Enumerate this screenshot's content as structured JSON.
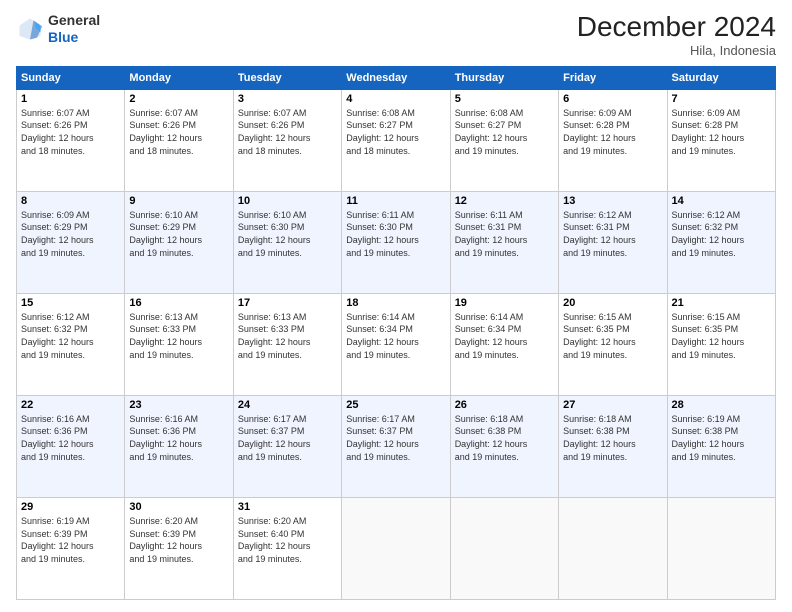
{
  "logo": {
    "general": "General",
    "blue": "Blue"
  },
  "header": {
    "month": "December 2024",
    "location": "Hila, Indonesia"
  },
  "days_of_week": [
    "Sunday",
    "Monday",
    "Tuesday",
    "Wednesday",
    "Thursday",
    "Friday",
    "Saturday"
  ],
  "weeks": [
    [
      {
        "day": "1",
        "sunrise": "6:07 AM",
        "sunset": "6:26 PM",
        "daylight": "12 hours and 18 minutes."
      },
      {
        "day": "2",
        "sunrise": "6:07 AM",
        "sunset": "6:26 PM",
        "daylight": "12 hours and 18 minutes."
      },
      {
        "day": "3",
        "sunrise": "6:07 AM",
        "sunset": "6:26 PM",
        "daylight": "12 hours and 18 minutes."
      },
      {
        "day": "4",
        "sunrise": "6:08 AM",
        "sunset": "6:27 PM",
        "daylight": "12 hours and 18 minutes."
      },
      {
        "day": "5",
        "sunrise": "6:08 AM",
        "sunset": "6:27 PM",
        "daylight": "12 hours and 19 minutes."
      },
      {
        "day": "6",
        "sunrise": "6:09 AM",
        "sunset": "6:28 PM",
        "daylight": "12 hours and 19 minutes."
      },
      {
        "day": "7",
        "sunrise": "6:09 AM",
        "sunset": "6:28 PM",
        "daylight": "12 hours and 19 minutes."
      }
    ],
    [
      {
        "day": "8",
        "sunrise": "6:09 AM",
        "sunset": "6:29 PM",
        "daylight": "12 hours and 19 minutes."
      },
      {
        "day": "9",
        "sunrise": "6:10 AM",
        "sunset": "6:29 PM",
        "daylight": "12 hours and 19 minutes."
      },
      {
        "day": "10",
        "sunrise": "6:10 AM",
        "sunset": "6:30 PM",
        "daylight": "12 hours and 19 minutes."
      },
      {
        "day": "11",
        "sunrise": "6:11 AM",
        "sunset": "6:30 PM",
        "daylight": "12 hours and 19 minutes."
      },
      {
        "day": "12",
        "sunrise": "6:11 AM",
        "sunset": "6:31 PM",
        "daylight": "12 hours and 19 minutes."
      },
      {
        "day": "13",
        "sunrise": "6:12 AM",
        "sunset": "6:31 PM",
        "daylight": "12 hours and 19 minutes."
      },
      {
        "day": "14",
        "sunrise": "6:12 AM",
        "sunset": "6:32 PM",
        "daylight": "12 hours and 19 minutes."
      }
    ],
    [
      {
        "day": "15",
        "sunrise": "6:12 AM",
        "sunset": "6:32 PM",
        "daylight": "12 hours and 19 minutes."
      },
      {
        "day": "16",
        "sunrise": "6:13 AM",
        "sunset": "6:33 PM",
        "daylight": "12 hours and 19 minutes."
      },
      {
        "day": "17",
        "sunrise": "6:13 AM",
        "sunset": "6:33 PM",
        "daylight": "12 hours and 19 minutes."
      },
      {
        "day": "18",
        "sunrise": "6:14 AM",
        "sunset": "6:34 PM",
        "daylight": "12 hours and 19 minutes."
      },
      {
        "day": "19",
        "sunrise": "6:14 AM",
        "sunset": "6:34 PM",
        "daylight": "12 hours and 19 minutes."
      },
      {
        "day": "20",
        "sunrise": "6:15 AM",
        "sunset": "6:35 PM",
        "daylight": "12 hours and 19 minutes."
      },
      {
        "day": "21",
        "sunrise": "6:15 AM",
        "sunset": "6:35 PM",
        "daylight": "12 hours and 19 minutes."
      }
    ],
    [
      {
        "day": "22",
        "sunrise": "6:16 AM",
        "sunset": "6:36 PM",
        "daylight": "12 hours and 19 minutes."
      },
      {
        "day": "23",
        "sunrise": "6:16 AM",
        "sunset": "6:36 PM",
        "daylight": "12 hours and 19 minutes."
      },
      {
        "day": "24",
        "sunrise": "6:17 AM",
        "sunset": "6:37 PM",
        "daylight": "12 hours and 19 minutes."
      },
      {
        "day": "25",
        "sunrise": "6:17 AM",
        "sunset": "6:37 PM",
        "daylight": "12 hours and 19 minutes."
      },
      {
        "day": "26",
        "sunrise": "6:18 AM",
        "sunset": "6:38 PM",
        "daylight": "12 hours and 19 minutes."
      },
      {
        "day": "27",
        "sunrise": "6:18 AM",
        "sunset": "6:38 PM",
        "daylight": "12 hours and 19 minutes."
      },
      {
        "day": "28",
        "sunrise": "6:19 AM",
        "sunset": "6:38 PM",
        "daylight": "12 hours and 19 minutes."
      }
    ],
    [
      {
        "day": "29",
        "sunrise": "6:19 AM",
        "sunset": "6:39 PM",
        "daylight": "12 hours and 19 minutes."
      },
      {
        "day": "30",
        "sunrise": "6:20 AM",
        "sunset": "6:39 PM",
        "daylight": "12 hours and 19 minutes."
      },
      {
        "day": "31",
        "sunrise": "6:20 AM",
        "sunset": "6:40 PM",
        "daylight": "12 hours and 19 minutes."
      },
      null,
      null,
      null,
      null
    ]
  ],
  "labels": {
    "sunrise": "Sunrise:",
    "sunset": "Sunset:",
    "daylight": "Daylight:"
  }
}
